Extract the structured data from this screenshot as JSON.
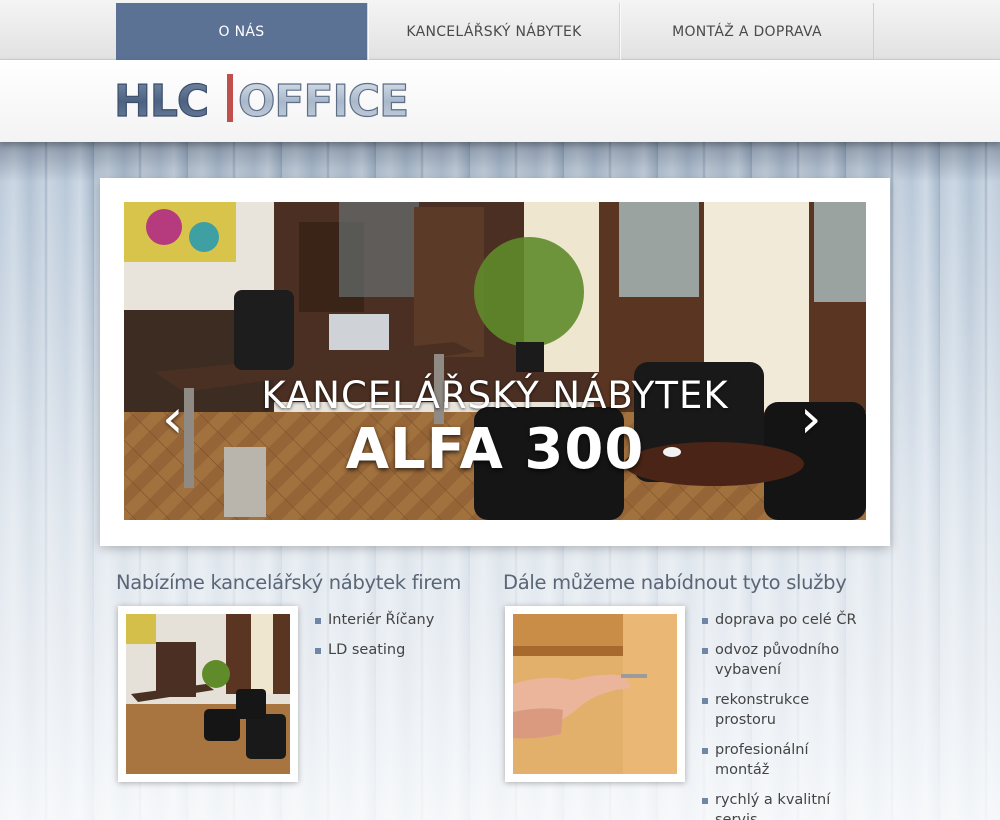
{
  "nav": {
    "items": [
      {
        "label": "O NÁS",
        "active": true
      },
      {
        "label": "KANCELÁŘSKÝ NÁBYTEK",
        "active": false
      },
      {
        "label": "MONTÁŽ A DOPRAVA",
        "active": false
      }
    ]
  },
  "logo": {
    "text_left": "HLC",
    "text_right": "OFFICE"
  },
  "slider": {
    "caption_line1": "KANCELÁŘSKÝ NÁBYTEK",
    "caption_line2": "ALFA 300",
    "prev_icon": "chevron-left-icon",
    "next_icon": "chevron-right-icon"
  },
  "left_section": {
    "title": "Nabízíme kancelářský nábytek firem",
    "items": [
      "Interiér Říčany",
      "LD seating"
    ]
  },
  "right_section": {
    "title": "Dále můžeme nabídnout tyto služby",
    "items": [
      "doprava po celé ČR",
      "odvoz původního vybavení",
      "rekonstrukce prostoru",
      "profesionální montáž",
      "rychlý a kvalitní servis"
    ]
  },
  "colors": {
    "nav_active": "#5c7295",
    "bullet": "#6f86a6",
    "logo_bar": "#c0504d"
  }
}
